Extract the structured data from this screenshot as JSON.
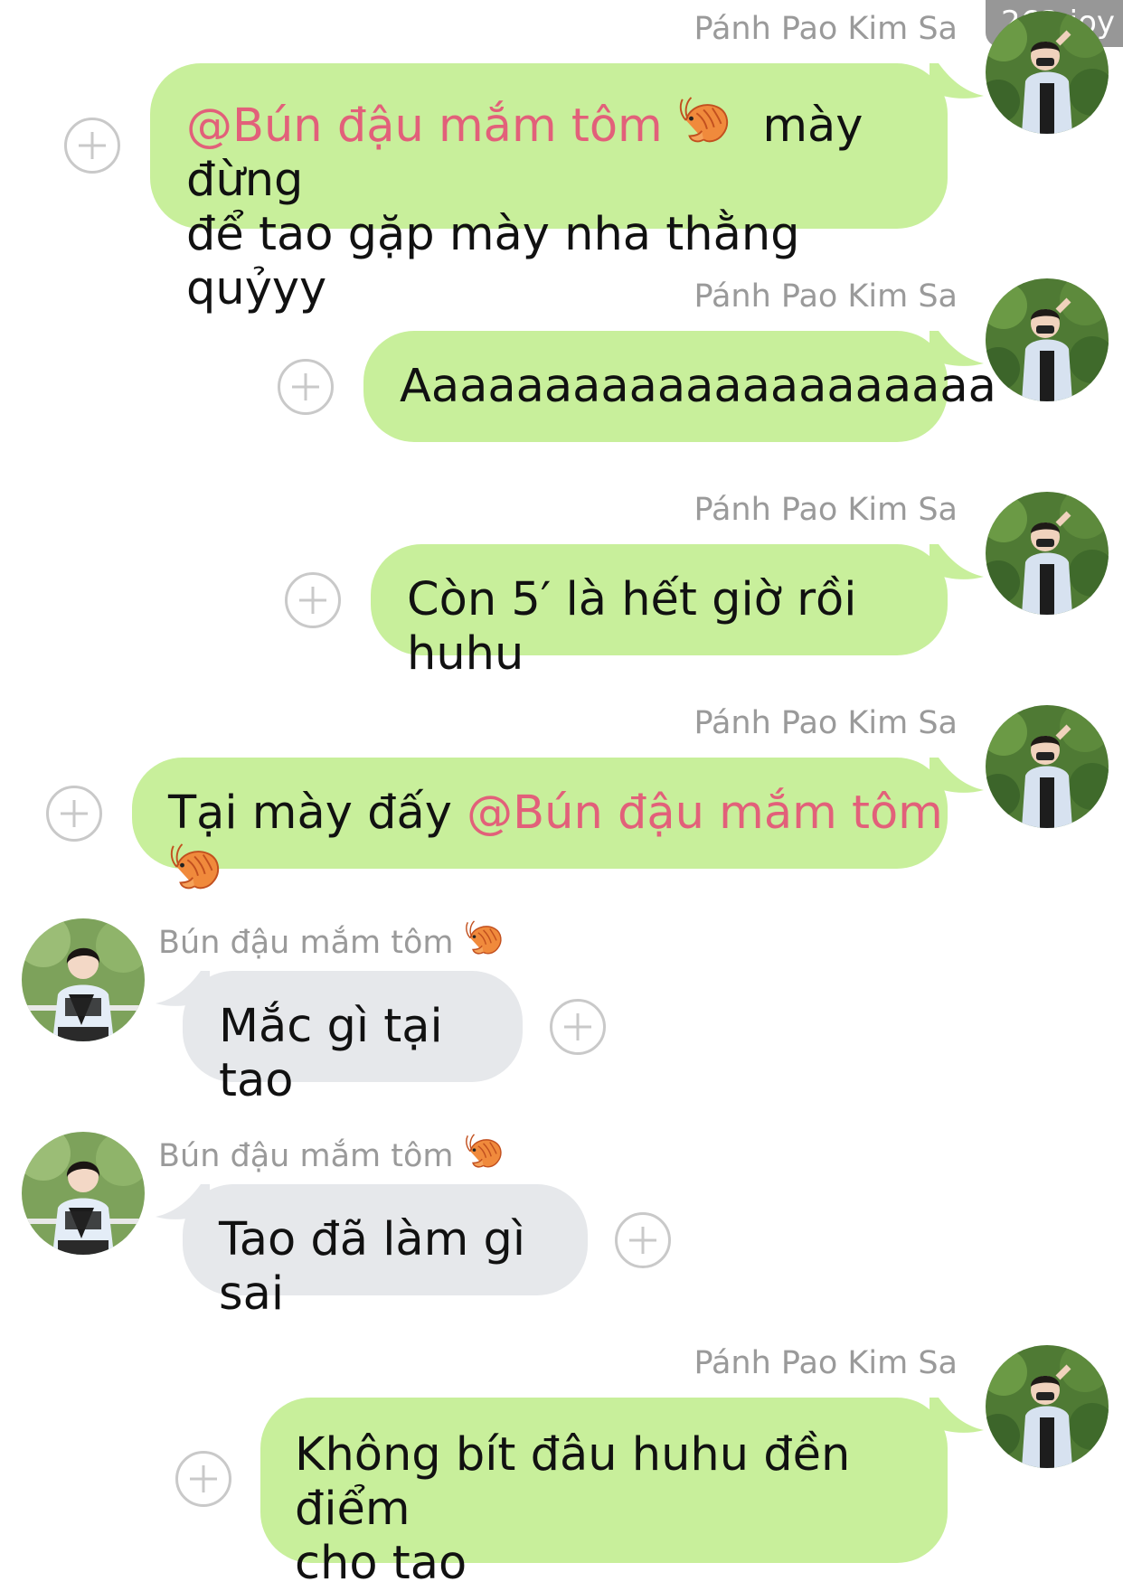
{
  "watermark": "263 joy",
  "colors": {
    "outgoing_bubble": "#c8ef9b",
    "incoming_bubble": "#e6e8eb",
    "mention": "#e2607a",
    "sender_name": "#9a9a9a"
  },
  "users": {
    "self_name": "Pánh Pao Kim Sa",
    "other_name": "Bún đậu mắm tôm"
  },
  "messages": [
    {
      "direction": "outgoing",
      "mention": "@Bún đậu mắm tôm",
      "text_line1": "mày đừng",
      "text_line2": "để tao gặp mày nha thằng quỷyy"
    },
    {
      "direction": "outgoing",
      "text": "Aaaaaaaaaaaaaaaaaaaaa"
    },
    {
      "direction": "outgoing",
      "text": "Còn 5′ là hết giờ rồi huhu"
    },
    {
      "direction": "outgoing",
      "text": "Tại mày đấy",
      "mention": "@Bún đậu mắm tôm"
    },
    {
      "direction": "incoming",
      "text": "Mắc gì tại tao"
    },
    {
      "direction": "incoming",
      "text": "Tao đã làm gì sai"
    },
    {
      "direction": "outgoing",
      "text_line1": "Không bít đâu huhu đền điểm",
      "text_line2": "cho tao"
    }
  ],
  "icons": {
    "react_button": "add-reaction-icon",
    "emoji": "shrimp-emoji-icon"
  }
}
